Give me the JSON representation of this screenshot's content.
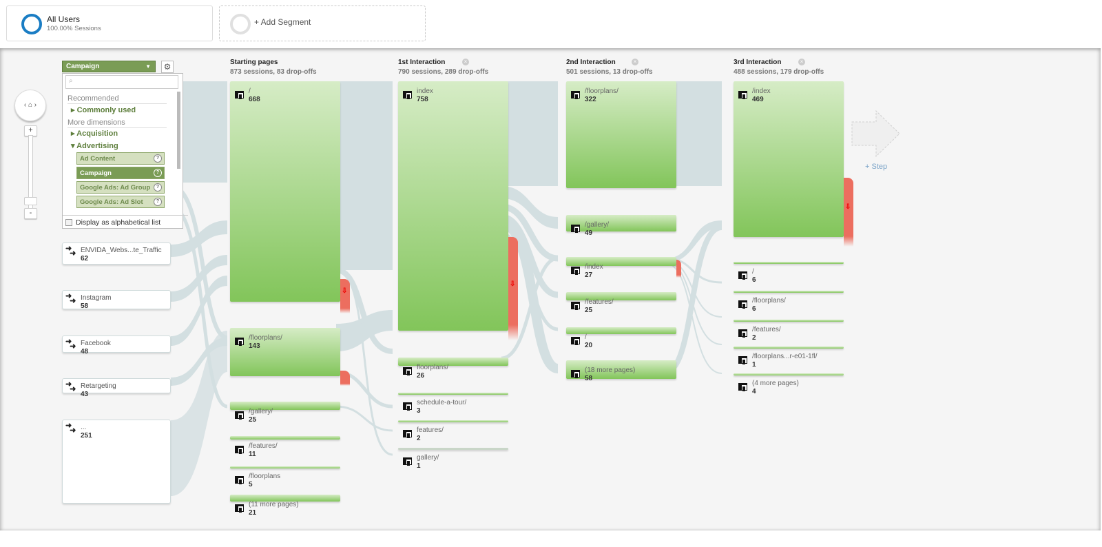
{
  "segments": {
    "all_users": {
      "title": "All Users",
      "subtitle": "100.00% Sessions",
      "ring_color": "#1a7dc4"
    },
    "add_segment": {
      "label": "+ Add Segment"
    }
  },
  "controls": {
    "home_icon": "home-icon",
    "zoom_in": "+",
    "zoom_out": "-"
  },
  "dimension": {
    "selected": "Campaign",
    "dropdown": {
      "search_placeholder": "",
      "groups": [
        {
          "label": "Recommended",
          "categories": [
            {
              "label": "Commonly used",
              "expanded": false
            }
          ]
        },
        {
          "label": "More dimensions",
          "categories": [
            {
              "label": "Acquisition",
              "expanded": false
            },
            {
              "label": "Advertising",
              "expanded": true,
              "options": [
                {
                  "label": "Ad Content",
                  "selected": false
                },
                {
                  "label": "Campaign",
                  "selected": true
                },
                {
                  "label": "Google Ads: Ad Group",
                  "selected": false
                },
                {
                  "label": "Google Ads: Ad Slot",
                  "selected": false
                }
              ]
            }
          ]
        }
      ],
      "alphabetical_label": "Display as alphabetical list",
      "alphabetical_checked": false
    }
  },
  "sources": [
    {
      "label": "ENVIDA_Webs...te_Traffic",
      "value": "62"
    },
    {
      "label": "Instagram",
      "value": "58"
    },
    {
      "label": "Facebook",
      "value": "48"
    },
    {
      "label": "Retargeting",
      "value": "43"
    },
    {
      "label": "...",
      "value": "251"
    }
  ],
  "columns": [
    {
      "title": "Starting pages",
      "subtitle": "873 sessions, 83 drop-offs",
      "closable": false,
      "nodes": [
        {
          "name": "/",
          "count": "668"
        },
        {
          "name": "/floorplans/",
          "count": "143"
        },
        {
          "name": "/gallery/",
          "count": "25"
        },
        {
          "name": "/features/",
          "count": "11"
        },
        {
          "name": "/floorplans",
          "count": "5"
        },
        {
          "name": "(11 more pages)",
          "count": "21"
        }
      ]
    },
    {
      "title": "1st Interaction",
      "subtitle": "790 sessions, 289 drop-offs",
      "closable": true,
      "nodes": [
        {
          "name": "index",
          "count": "758"
        },
        {
          "name": "floorplans/",
          "count": "26"
        },
        {
          "name": "schedule-a-tour/",
          "count": "3"
        },
        {
          "name": "features/",
          "count": "2"
        },
        {
          "name": "gallery/",
          "count": "1"
        }
      ]
    },
    {
      "title": "2nd Interaction",
      "subtitle": "501 sessions, 13 drop-offs",
      "closable": true,
      "nodes": [
        {
          "name": "/floorplans/",
          "count": "322"
        },
        {
          "name": "/gallery/",
          "count": "49"
        },
        {
          "name": "/index",
          "count": "27"
        },
        {
          "name": "/features/",
          "count": "25"
        },
        {
          "name": "/",
          "count": "20"
        },
        {
          "name": "(18 more pages)",
          "count": "58"
        }
      ]
    },
    {
      "title": "3rd Interaction",
      "subtitle": "488 sessions, 179 drop-offs",
      "closable": true,
      "nodes": [
        {
          "name": "/index",
          "count": "469"
        },
        {
          "name": "/",
          "count": "6"
        },
        {
          "name": "/floorplans/",
          "count": "6"
        },
        {
          "name": "/features/",
          "count": "2"
        },
        {
          "name": "/floorplans...r-e01-1fl/",
          "count": "1"
        },
        {
          "name": "(4 more pages)",
          "count": "4"
        }
      ]
    }
  ],
  "add_step": {
    "label": "+ Step"
  },
  "colors": {
    "node_top": "#d6ecc6",
    "node_bottom": "#82c55a",
    "dropoff": "#ec6e5f",
    "flow": "#d3dfe1",
    "accent": "#7a9c55"
  }
}
